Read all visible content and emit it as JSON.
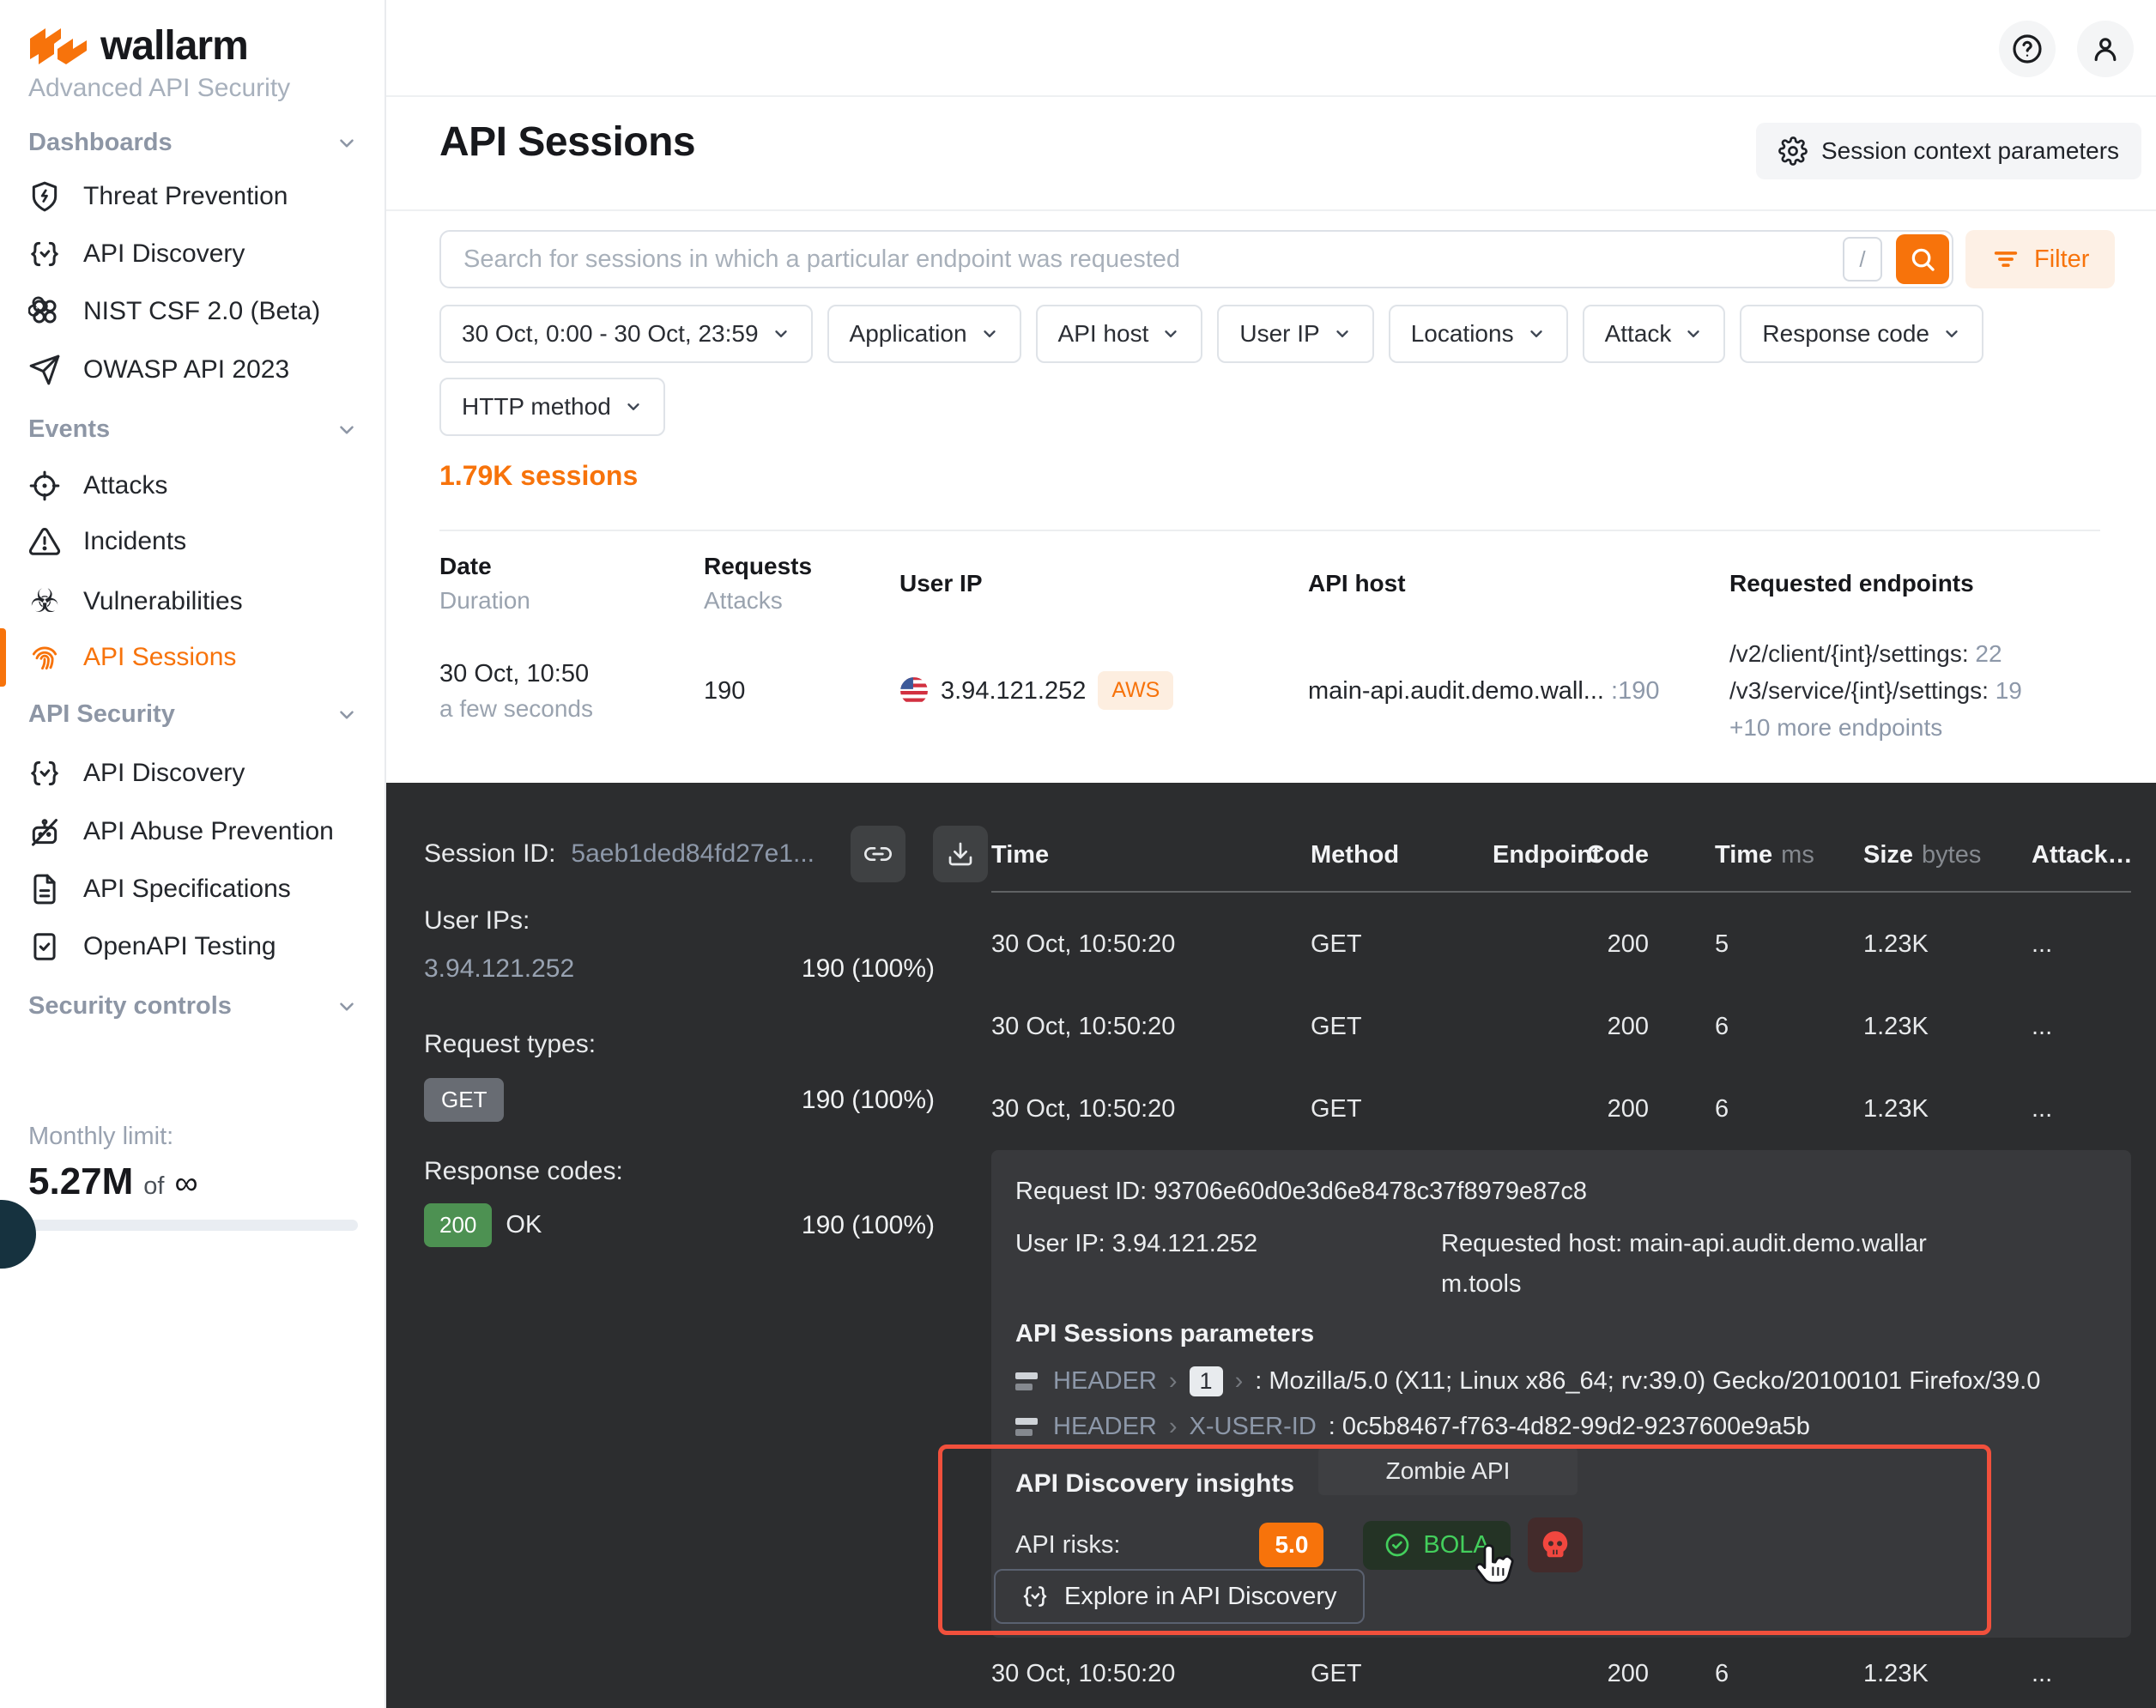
{
  "brand": {
    "name": "wallarm",
    "subtitle": "Advanced API Security"
  },
  "sidebar": {
    "sections": [
      {
        "label": "Dashboards",
        "items": [
          {
            "label": "Threat Prevention"
          },
          {
            "label": "API Discovery"
          },
          {
            "label": "NIST CSF 2.0 (Beta)"
          },
          {
            "label": "OWASP API 2023"
          }
        ]
      },
      {
        "label": "Events",
        "items": [
          {
            "label": "Attacks"
          },
          {
            "label": "Incidents"
          },
          {
            "label": "Vulnerabilities"
          },
          {
            "label": "API Sessions"
          }
        ]
      },
      {
        "label": "API Security",
        "items": [
          {
            "label": "API Discovery"
          },
          {
            "label": "API Abuse Prevention"
          },
          {
            "label": "API Specifications"
          },
          {
            "label": "OpenAPI Testing"
          }
        ]
      },
      {
        "label": "Security controls",
        "items": []
      }
    ],
    "monthly_limit": {
      "label": "Monthly limit:",
      "value": "5.27M",
      "of": "of",
      "infinity": "∞"
    }
  },
  "header": {
    "title": "API Sessions",
    "context_button": "Session context parameters"
  },
  "search": {
    "placeholder": "Search for sessions in which a particular endpoint was requested",
    "shortcut": "/",
    "filter_label": "Filter"
  },
  "filters": [
    {
      "label": "30 Oct, 0:00 - 30 Oct, 23:59"
    },
    {
      "label": "Application"
    },
    {
      "label": "API host"
    },
    {
      "label": "User IP"
    },
    {
      "label": "Locations"
    },
    {
      "label": "Attack"
    },
    {
      "label": "Response code"
    },
    {
      "label": "HTTP method"
    }
  ],
  "sessions": {
    "count_label": "1.79K sessions",
    "columns": [
      {
        "label": "Date",
        "sub": "Duration"
      },
      {
        "label": "Requests",
        "sub": "Attacks"
      },
      {
        "label": "User IP"
      },
      {
        "label": "API host"
      },
      {
        "label": "Requested endpoints"
      }
    ],
    "row": {
      "date": "30 Oct, 10:50",
      "duration": "a few seconds",
      "requests": "190",
      "user_ip": "3.94.121.252",
      "ip_tag": "AWS",
      "api_host": "main-api.audit.demo.wall...",
      "api_host_count": ":190",
      "endpoints": [
        {
          "path": "/v2/client/{int}/settings:",
          "count": "22"
        },
        {
          "path": "/v3/service/{int}/settings:",
          "count": "19"
        }
      ],
      "more": "+10 more endpoints"
    }
  },
  "session_panel": {
    "session_id_label": "Session ID:",
    "session_id": "5aeb1ded84fd27e1...",
    "user_ips_label": "User IPs:",
    "user_ip": "3.94.121.252",
    "user_ip_stat": "190 (100%)",
    "request_types_label": "Request types:",
    "request_type": "GET",
    "request_type_stat": "190 (100%)",
    "response_codes_label": "Response codes:",
    "response_code": "200",
    "response_code_text": "OK",
    "response_code_stat": "190 (100%)",
    "table": {
      "columns": [
        {
          "label": "Time"
        },
        {
          "label": "Method"
        },
        {
          "label": "Endpoint"
        },
        {
          "label": "Code"
        },
        {
          "label": "Time",
          "unit": "ms"
        },
        {
          "label": "Size",
          "unit": "bytes"
        },
        {
          "label": "Attack…"
        }
      ],
      "rows": [
        {
          "time": "30 Oct, 10:50:20",
          "method": "GET",
          "endpoint": "",
          "code": "200",
          "time_ms": "5",
          "size": "1.23K",
          "attacks": "..."
        },
        {
          "time": "30 Oct, 10:50:20",
          "method": "GET",
          "endpoint": "",
          "code": "200",
          "time_ms": "6",
          "size": "1.23K",
          "attacks": "..."
        },
        {
          "time": "30 Oct, 10:50:20",
          "method": "GET",
          "endpoint": "",
          "code": "200",
          "time_ms": "6",
          "size": "1.23K",
          "attacks": "..."
        },
        {
          "time": "30 Oct, 10:50:20",
          "method": "GET",
          "endpoint": "",
          "code": "200",
          "time_ms": "6",
          "size": "1.23K",
          "attacks": "..."
        }
      ]
    },
    "detail": {
      "request_id_label": "Request ID:",
      "request_id": "93706e60d0e3d6e8478c37f8979e87c8",
      "user_ip_label": "User IP:",
      "user_ip": "3.94.121.252",
      "requested_host_label": "Requested host:",
      "requested_host": "main-api.audit.demo.wallarm.tools",
      "params_title": "API Sessions parameters",
      "param_separator": "›",
      "params": [
        {
          "source": "HEADER",
          "key": "1",
          "value": ": Mozilla/5.0 (X11; Linux x86_64; rv:39.0) Gecko/20100101 Firefox/39.0"
        },
        {
          "source": "HEADER",
          "key": "X-USER-ID",
          "value": ": 0c5b8467-f763-4d82-99d2-9237600e9a5b"
        }
      ],
      "insights": {
        "title": "API Discovery insights",
        "tooltip": "Zombie API",
        "risks_label": "API risks:",
        "risk_score": "5.0",
        "bola_label": "BOLA",
        "explore_button": "Explore in API Discovery"
      }
    }
  },
  "colors": {
    "accent_orange": "#f7730b",
    "annotation_red": "#f1503c",
    "success_green": "#4d9152",
    "bola_green": "#43cf5c",
    "skull_red": "#f2473f"
  }
}
